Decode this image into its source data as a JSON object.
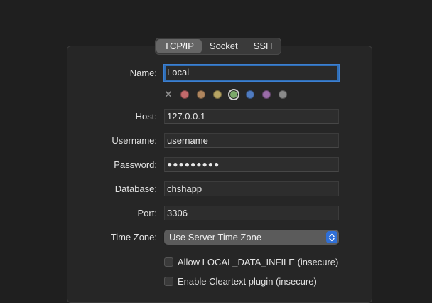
{
  "tabs": [
    {
      "label": "TCP/IP",
      "selected": true
    },
    {
      "label": "Socket",
      "selected": false
    },
    {
      "label": "SSH",
      "selected": false
    }
  ],
  "form": {
    "name": {
      "label": "Name:",
      "value": "Local"
    },
    "host": {
      "label": "Host:",
      "value": "127.0.0.1"
    },
    "username": {
      "label": "Username:",
      "value": "username"
    },
    "password": {
      "label": "Password:",
      "value": "●●●●●●●●●"
    },
    "database": {
      "label": "Database:",
      "value": "chshapp"
    },
    "port": {
      "label": "Port:",
      "value": "3306"
    },
    "timezone": {
      "label": "Time Zone:",
      "value": "Use Server Time Zone"
    }
  },
  "color_tags": {
    "none_icon": "close-icon",
    "colors": [
      "#c46a6c",
      "#b0865e",
      "#b7a563",
      "#7ba86a",
      "#4f7bc0",
      "#9a6ca8",
      "#8a8a8a"
    ],
    "selected": "#7ba86a"
  },
  "checkboxes": {
    "local_infile": {
      "label": "Allow LOCAL_DATA_INFILE (insecure)",
      "checked": false
    },
    "cleartext": {
      "label": "Enable Cleartext plugin (insecure)",
      "checked": false
    }
  },
  "theme": {
    "accent": "#2f6fd6",
    "focus_ring": "#2f6fb8"
  }
}
